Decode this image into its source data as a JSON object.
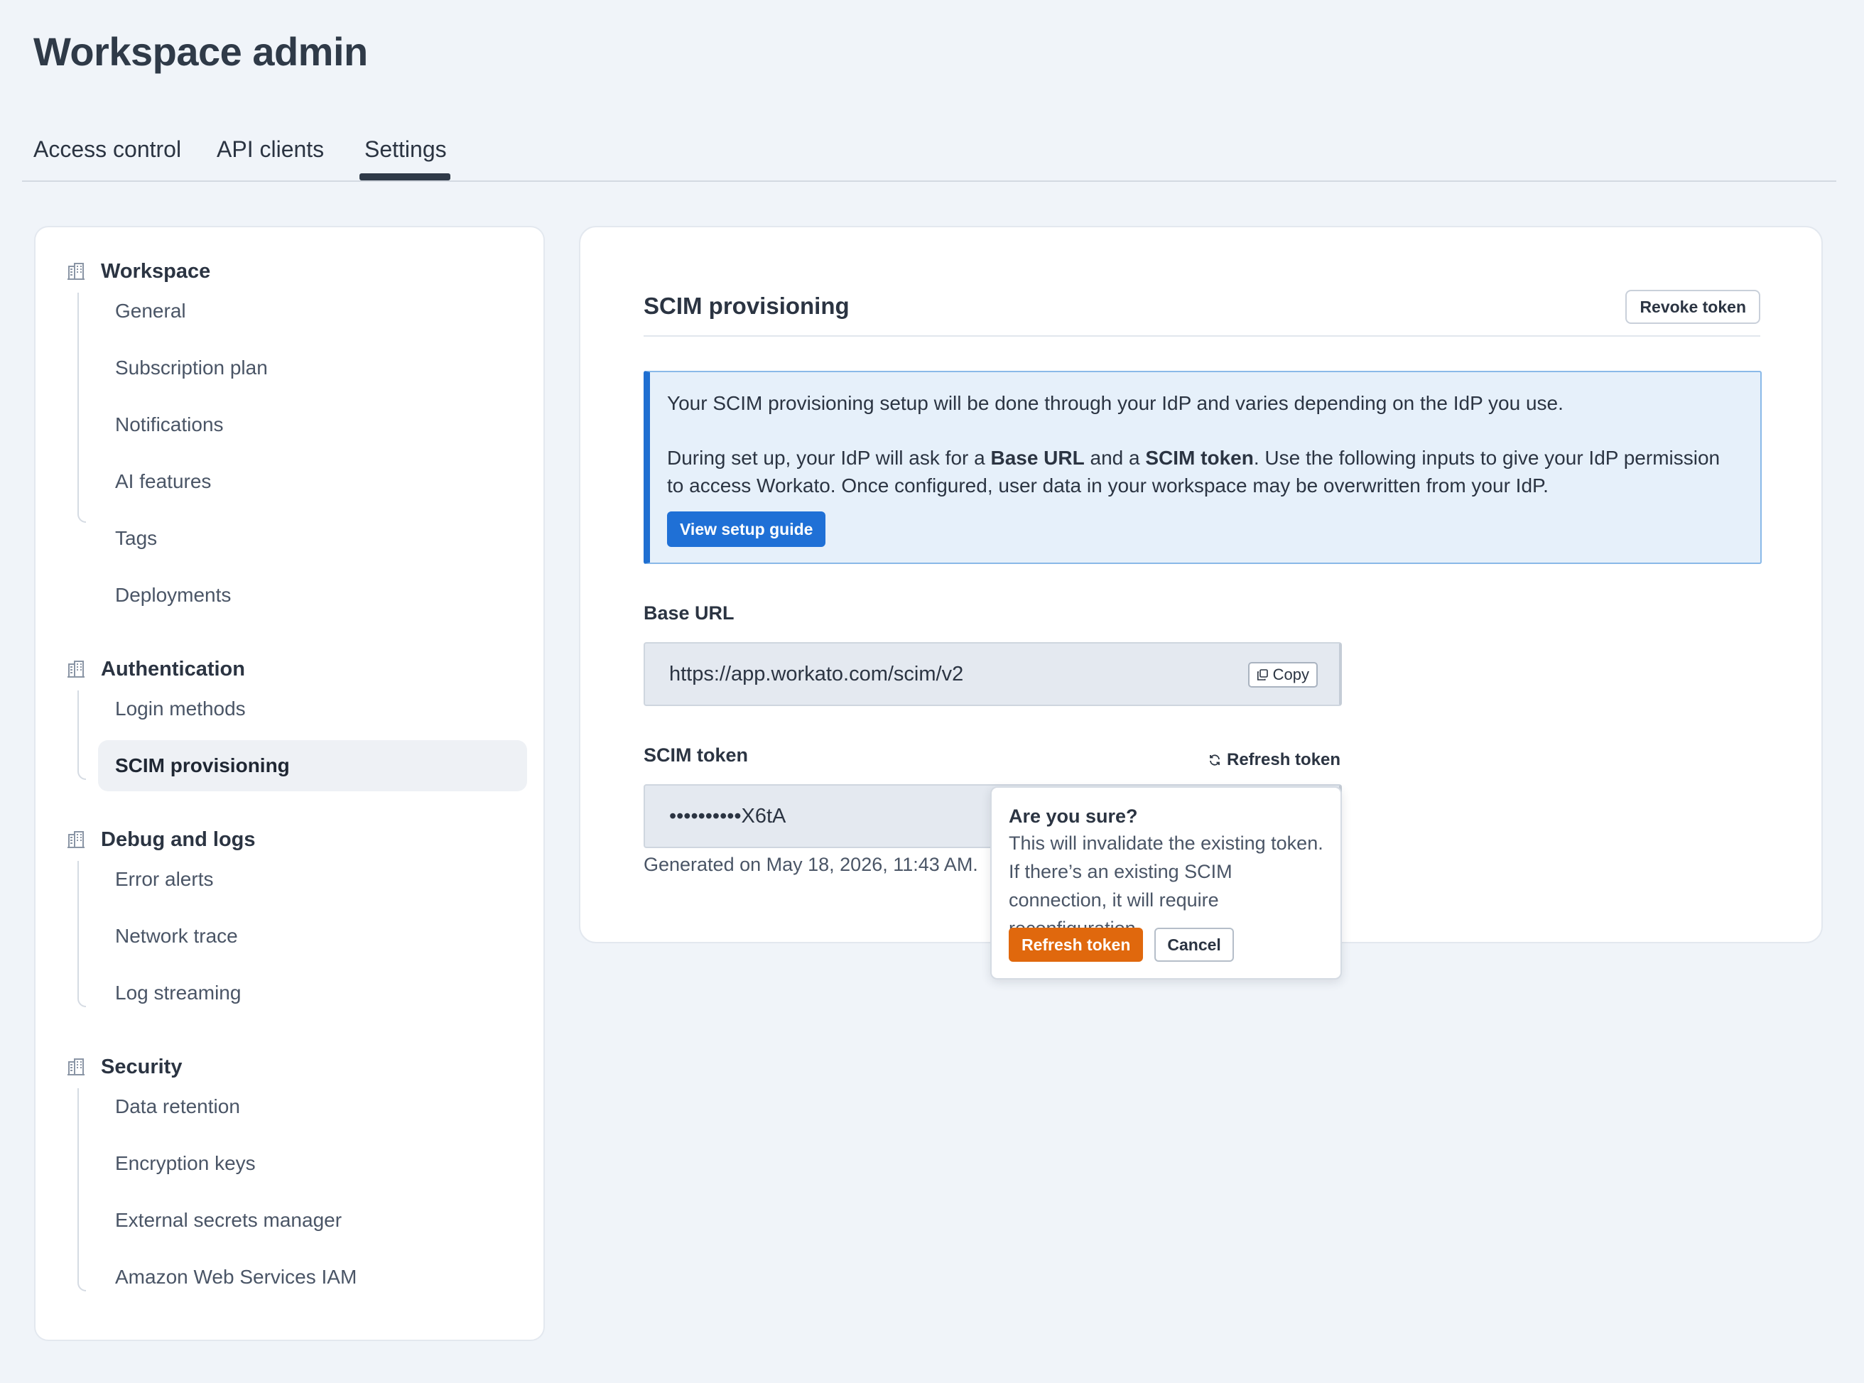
{
  "page": {
    "title": "Workspace admin"
  },
  "tabs": [
    {
      "label": "Access control",
      "active": false
    },
    {
      "label": "API clients",
      "active": false
    },
    {
      "label": "Settings",
      "active": true
    }
  ],
  "sidebar": {
    "sections": [
      {
        "title": "Workspace",
        "icon": "building-icon",
        "items": [
          "General",
          "Subscription plan",
          "Notifications",
          "AI features",
          "Tags",
          "Deployments"
        ]
      },
      {
        "title": "Authentication",
        "icon": "building-icon",
        "items": [
          "Login methods",
          "SCIM provisioning"
        ],
        "active_item": "SCIM provisioning"
      },
      {
        "title": "Debug and logs",
        "icon": "building-icon",
        "items": [
          "Error alerts",
          "Network trace",
          "Log streaming"
        ]
      },
      {
        "title": "Security",
        "icon": "building-icon",
        "items": [
          "Data retention",
          "Encryption keys",
          "External secrets manager",
          "Amazon Web Services IAM"
        ]
      }
    ]
  },
  "main": {
    "title": "SCIM provisioning",
    "revoke_label": "Revoke token",
    "info": {
      "p1": "Your SCIM provisioning setup will be done through your IdP and varies depending on the IdP you use.",
      "p2_a": "During set up, your IdP will ask for a ",
      "p2_b": "Base URL",
      "p2_c": " and a ",
      "p2_d": "SCIM token",
      "p2_e": ". Use the following inputs to give your IdP permission to access Workato. Once configured, user data in your workspace may be overwritten from your IdP.",
      "button": "View setup guide"
    },
    "base_url": {
      "label": "Base URL",
      "value": "https://app.workato.com/scim/v2",
      "copy_label": "Copy"
    },
    "scim_token": {
      "label": "SCIM token",
      "refresh_label": "Refresh token",
      "value": "••••••••••X6tA",
      "generated": "Generated on May 18, 2026, 11:43 AM."
    }
  },
  "popover": {
    "title": "Are you sure?",
    "text": "This will invalidate the existing token. If there’s an existing SCIM connection, it will require reconfiguration.",
    "confirm_label": "Refresh token",
    "cancel_label": "Cancel"
  },
  "colors": {
    "primary": "#1f70d6",
    "warning": "#e0680d",
    "background": "#f0f4f9"
  }
}
